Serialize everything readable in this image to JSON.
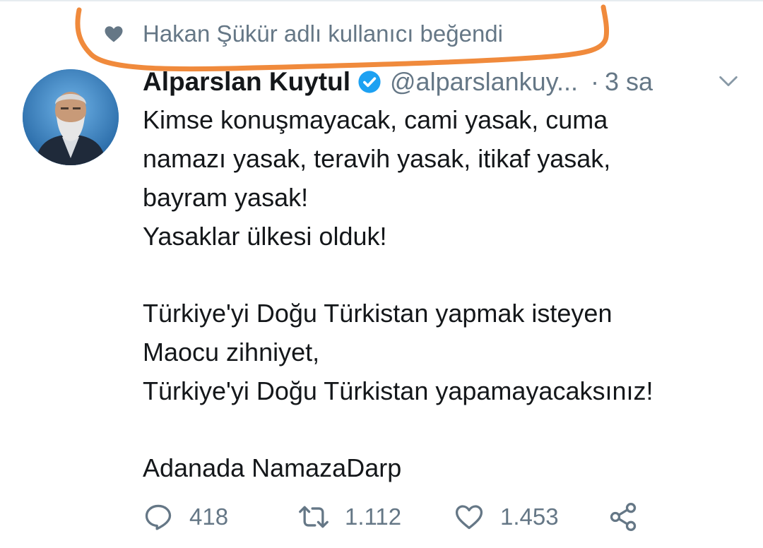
{
  "social_context": {
    "text": "Hakan Şükür adlı kullanıcı beğendi",
    "icon": "heart-icon"
  },
  "tweet": {
    "author": {
      "name": "Alparslan Kuytul",
      "handle": "@alparslankuy...",
      "verified": true
    },
    "time": "3 sa",
    "separator": "·",
    "lines": [
      "Kimse konuşmayacak, cami yasak, cuma",
      "namazı yasak, teravih yasak, itikaf yasak,",
      "bayram yasak!",
      "Yasaklar ülkesi olduk!",
      "",
      "Türkiye'yi  Doğu Türkistan yapmak isteyen",
      "Maocu zihniyet,",
      "Türkiye'yi Doğu Türkistan yapamayacaksınız!",
      "",
      "Adanada NamazaDarp"
    ],
    "actions": {
      "reply_count": "418",
      "retweet_count": "1.112",
      "like_count": "1.453"
    }
  },
  "colors": {
    "secondary_text": "#657786",
    "verified_blue": "#1da1f2",
    "highlight_orange": "#f08a3c"
  }
}
